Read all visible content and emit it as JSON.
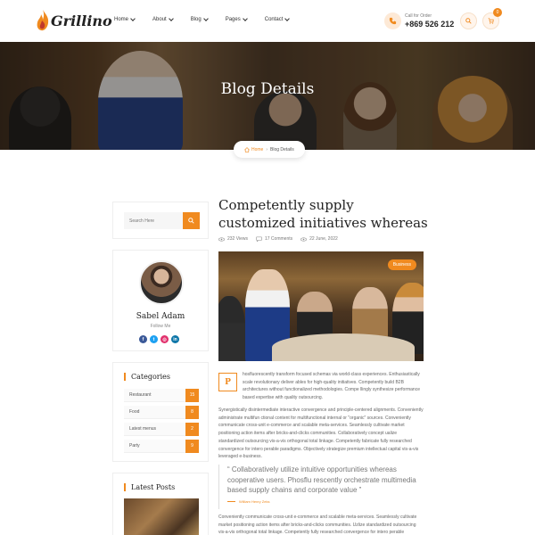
{
  "header": {
    "logo_text": "Grillino",
    "nav": [
      "Home",
      "About",
      "Blog",
      "Pages",
      "Contact"
    ],
    "call_label": "Call for Order",
    "call_number": "+869 526 212",
    "cart_count": "0",
    "brand_color": "#f08a1f"
  },
  "hero": {
    "title": "Blog Details",
    "breadcrumb_home": "Home",
    "breadcrumb_current": "Blog Details"
  },
  "sidebar": {
    "search_placeholder": "Search Here",
    "author_name": "Sabel Adam",
    "author_follow": "Follow Me",
    "socials": [
      "facebook-icon",
      "twitter-icon",
      "instagram-icon",
      "linkedin-icon"
    ],
    "categories_title": "Categories",
    "categories": [
      {
        "name": "Restaurant",
        "count": "15"
      },
      {
        "name": "Food",
        "count": "8"
      },
      {
        "name": "Latest menus",
        "count": "2"
      },
      {
        "name": "Party",
        "count": "9"
      }
    ],
    "latest_title": "Latest Posts"
  },
  "post": {
    "title": "Competently supply customized initiatives whereas",
    "views": "232 Views",
    "comments": "17 Comments",
    "date": "22 June, 2022",
    "tag": "Business",
    "dropcap": "P",
    "para1": "hosfluorescently transform focused schemas via world-class experiences. Enthusiastically scale revolutionary deliver ables for high-quality initiatives. Competently build B2B architectures without functionalized methodologies. Compe llingly synthesize performance based expertise with quality outsourcing.",
    "para2": "Synergistically disintermediate interactive convergence and principle-centered alignments. Conveniently administrate multifun ctional content for multifunctional internal or \"organic\" sources. Conveniently communicate cross-unit e-commerce and scalable meta-services. Seamlessly cultivate market positioning action items after bricks-and-clicks communities. Collaboratively concept ualize standardized outsourcing vis-a-vis orthogonal total linkage. Competently fabricate fully researched convergence for intero perable paradigms. Objectively strategize premium intellectual capital vis-a-vis leveraged e-business.",
    "quote": "“ Collaboratively utilize intuitive opportunities whereas cooperative users. Phosflu rescently orchestrate multimedia based supply chains and corporate value ”",
    "quote_author": "William Henry Zeks",
    "para3": "Conveniently communicate cross-unit e-commerce and scalable meta-services. Seamlessly cultivate market positioning action items after bricks-and-clicks communities. Uzlize standardized outsourcing vis-a-vis orthogonal total linkage. Competently fully researched convergence for intero perable"
  }
}
